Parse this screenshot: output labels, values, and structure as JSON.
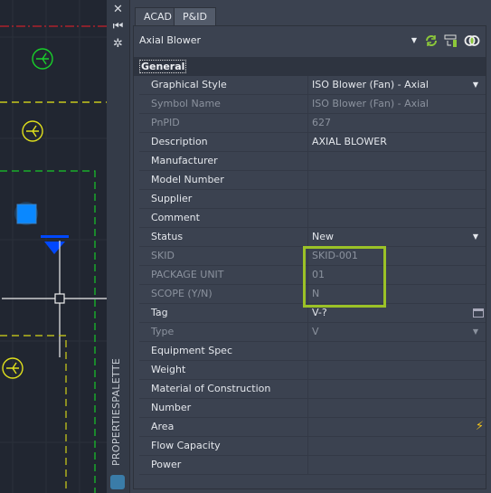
{
  "palette": {
    "title": "PROPERTIESPALETTE",
    "buttons": [
      "close",
      "auto-hide",
      "properties"
    ]
  },
  "tabs": [
    {
      "label": "ACAD",
      "active": false
    },
    {
      "label": "P&ID",
      "active": true
    }
  ],
  "object_selector": {
    "value": "Axial Blower"
  },
  "toolbar": [
    "refresh-icon",
    "select-objects-icon",
    "toggle-pickadd-icon"
  ],
  "category": "General",
  "properties": [
    {
      "label": "Graphical Style",
      "value": "ISO Blower (Fan) - Axial",
      "readonly": false,
      "control": "dropdown"
    },
    {
      "label": "Symbol Name",
      "value": "ISO Blower (Fan) - Axial",
      "readonly": true
    },
    {
      "label": "PnPID",
      "value": "627",
      "readonly": true
    },
    {
      "label": "Description",
      "value": "AXIAL BLOWER",
      "readonly": false
    },
    {
      "label": "Manufacturer",
      "value": "",
      "readonly": false
    },
    {
      "label": "Model Number",
      "value": "",
      "readonly": false
    },
    {
      "label": "Supplier",
      "value": "",
      "readonly": false
    },
    {
      "label": "Comment",
      "value": "",
      "readonly": false
    },
    {
      "label": "Status",
      "value": "New",
      "readonly": false,
      "control": "dropdown"
    },
    {
      "label": "SKID",
      "value": "SKID-001",
      "readonly": true
    },
    {
      "label": "PACKAGE UNIT",
      "value": "01",
      "readonly": true
    },
    {
      "label": "SCOPE (Y/N)",
      "value": "N",
      "readonly": true
    },
    {
      "label": "Tag",
      "value": "V-?",
      "readonly": false,
      "control": "dialog"
    },
    {
      "label": "Type",
      "value": "V",
      "readonly": true,
      "control": "dropdown"
    },
    {
      "label": "Equipment Spec",
      "value": "",
      "readonly": false
    },
    {
      "label": "Weight",
      "value": "",
      "readonly": false
    },
    {
      "label": "Material of Construction",
      "value": "",
      "readonly": false
    },
    {
      "label": "Number",
      "value": "",
      "readonly": false
    },
    {
      "label": "Area",
      "value": "",
      "readonly": false,
      "control": "lightning"
    },
    {
      "label": "Flow Capacity",
      "value": "",
      "readonly": false
    },
    {
      "label": "Power",
      "value": "",
      "readonly": false
    }
  ],
  "colors": {
    "highlight": "#9bc227",
    "panel": "#3b4250",
    "canvas": "#212631"
  }
}
